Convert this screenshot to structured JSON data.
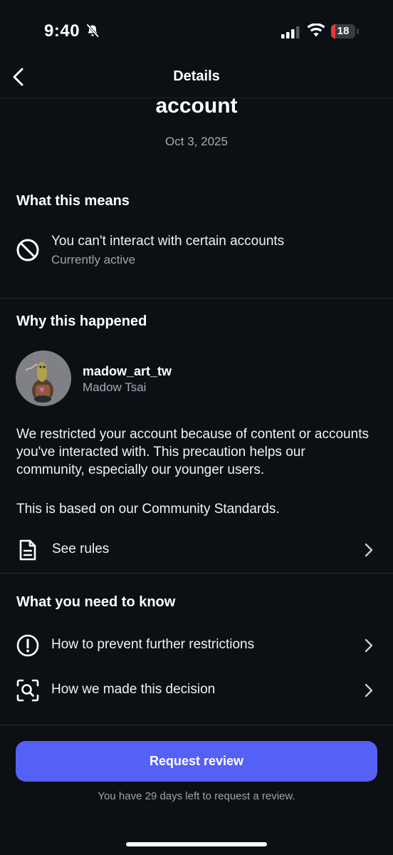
{
  "status_bar": {
    "time": "9:40",
    "battery_level": "18",
    "battery_fraction": 0.18,
    "battery_color": "#e5383b"
  },
  "header": {
    "title": "Details",
    "back_icon": "chevron-left-icon"
  },
  "summary": {
    "title_partial": "account",
    "date": "Oct 3, 2025"
  },
  "what_this_means": {
    "title": "What this means",
    "item": {
      "icon": "prohibited-icon",
      "label": "You can't interact with certain accounts",
      "status": "Currently active"
    }
  },
  "why_this_happened": {
    "title": "Why this happened",
    "account": {
      "username": "madow_art_tw",
      "name": "Madow Tsai"
    },
    "paragraph_1": "We restricted your account because of content or accounts you've interacted with. This precaution helps our community, especially our younger users.",
    "paragraph_2": "This is based on our Community Standards.",
    "see_rules": {
      "icon": "document-icon",
      "label": "See rules"
    }
  },
  "what_you_need_to_know": {
    "title": "What you need to know",
    "items": [
      {
        "icon": "exclamation-circle-icon",
        "label": "How to prevent further restrictions"
      },
      {
        "icon": "scan-search-icon",
        "label": "How we made this decision"
      }
    ]
  },
  "footer": {
    "button_label": "Request review",
    "button_color": "#5460f6",
    "note": "You have 29 days left to request a review."
  }
}
